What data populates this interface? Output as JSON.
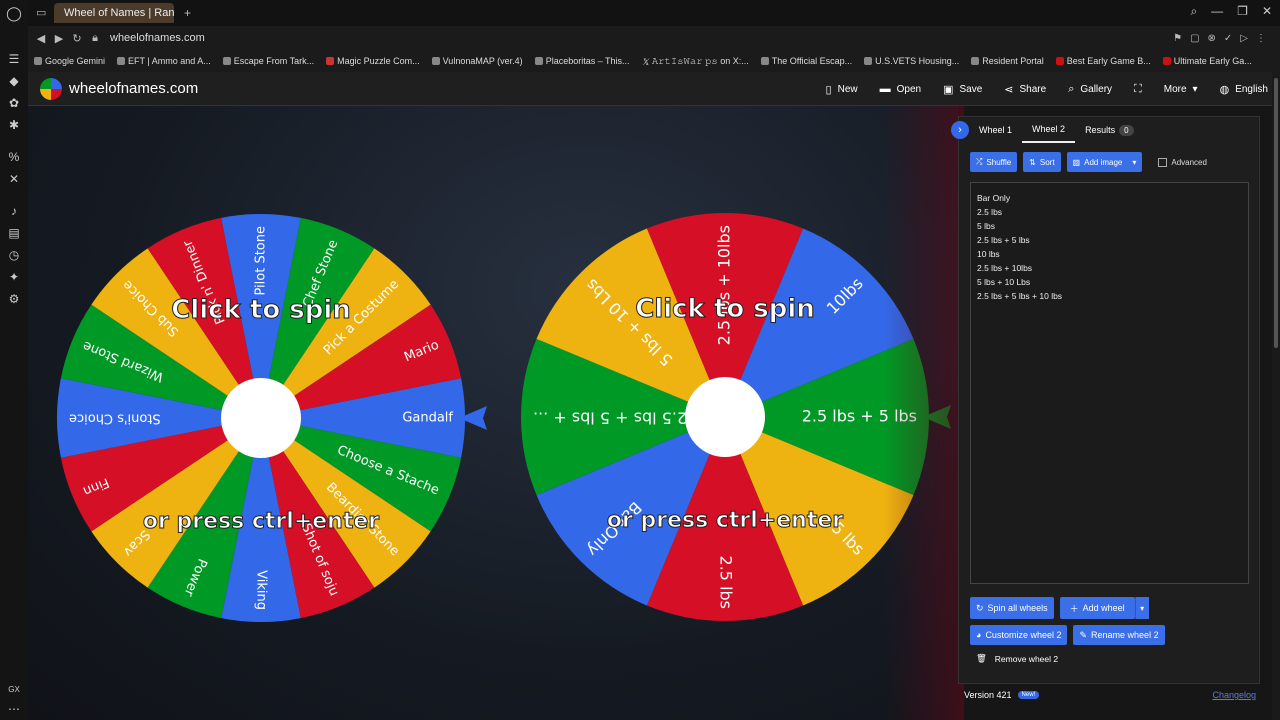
{
  "browser": {
    "tab_title": "Wheel of Names | Random",
    "url": "wheelofnames.com",
    "bookmarks": [
      "Google Gemini",
      "EFT | Ammo and A...",
      "Escape From Tark...",
      "Magic Puzzle Com...",
      "VulnonaMAP (ver.4)",
      "Placeboritas – This...",
      "𝙰𝚛𝚝𝙸𝚜𝚆𝚊𝚛 𝚙𝚜 on X:...",
      "The Official Escap...",
      "U.S.VETS Housing...",
      "Resident Portal",
      "Best Early Game B...",
      "Ultimate Early Ga..."
    ],
    "sidebar_bottom": "GX"
  },
  "app": {
    "site_name": "wheelofnames.com",
    "menu": {
      "new": "New",
      "open": "Open",
      "save": "Save",
      "share": "Share",
      "gallery": "Gallery",
      "more": "More",
      "language": "English"
    }
  },
  "wheel1": {
    "slices": [
      "Gandalf",
      "Choose a Stache",
      "Beardier Stone",
      "Shot of soju",
      "Viking",
      "Power",
      "Scav",
      "Finn",
      "Stoni's Choice",
      "Wizard Stone",
      "Sub Choice",
      "Pick n' Dinner",
      "Pilot Stone",
      "Chef Stone",
      "Pick a Costume",
      "Mario"
    ],
    "colors": [
      "#3369e8",
      "#009925",
      "#eeb211",
      "#d50f25"
    ],
    "spin_text": "Click to spin",
    "press_text": "or press ctrl+enter"
  },
  "wheel2": {
    "slices": [
      "2.5 lbs + 5 lbs",
      "5 lbs",
      "2.5 lbs",
      "Bar Only",
      "2.5 lbs + 5 lbs + ...",
      "5 lbs + 10 Lbs",
      "2.5 lbs + 10lbs",
      "10lbs"
    ],
    "colors": [
      "#009925",
      "#eeb211",
      "#d50f25",
      "#3369e8",
      "#009925",
      "#eeb211",
      "#d50f25",
      "#3369e8"
    ],
    "spin_text": "Click to spin",
    "press_text": "or press ctrl+enter"
  },
  "panel": {
    "tabs": [
      "Wheel 1",
      "Wheel 2",
      "Results"
    ],
    "results_count": "0",
    "shuffle": "Shuffle",
    "sort": "Sort",
    "add_image": "Add image",
    "advanced": "Advanced",
    "entries": [
      "Bar Only",
      "2.5 lbs",
      "5 lbs",
      "2.5 lbs + 5 lbs",
      "10 lbs",
      "2.5 lbs + 10lbs",
      "5 lbs + 10 Lbs",
      "2.5 lbs + 5 lbs + 10 lbs"
    ],
    "spin_all": "Spin all wheels",
    "add_wheel": "Add wheel",
    "customize": "Customize wheel 2",
    "rename": "Rename wheel 2",
    "remove": "Remove wheel 2"
  },
  "footer": {
    "version": "Version 421",
    "new_badge": "New!",
    "changelog": "Changelog"
  }
}
